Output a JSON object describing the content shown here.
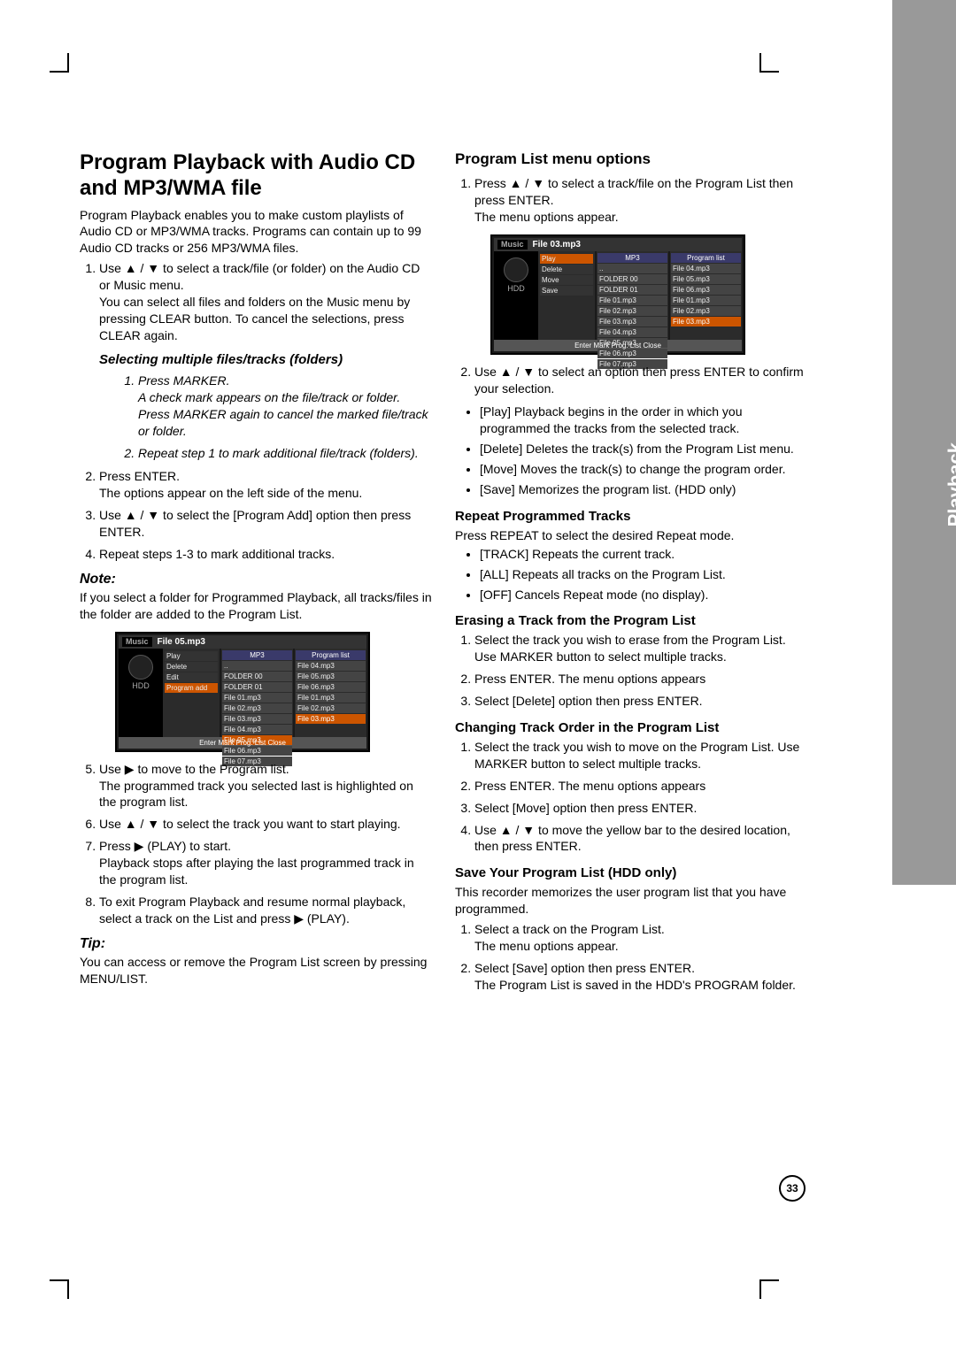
{
  "sideTab": "Playback",
  "pageNumber": "33",
  "left": {
    "h1": "Program Playback with Audio CD and MP3/WMA file",
    "intro": "Program Playback enables you to make custom playlists of Audio CD or MP3/WMA tracks. Programs can contain up to 99 Audio CD tracks or 256 MP3/WMA files.",
    "step1a": "Use ▲ / ▼ to select a track/file (or folder) on the Audio CD or Music menu.",
    "step1b": "You can select all files and folders on the Music menu by pressing CLEAR button. To cancel the selections, press CLEAR again.",
    "selHeading": "Selecting multiple files/tracks (folders)",
    "sel1a": "Press MARKER.",
    "sel1b": "A check mark appears on the file/track or folder. Press MARKER again to cancel the marked file/track or folder.",
    "sel2": "Repeat step 1 to mark additional file/track (folders).",
    "step2a": "Press ENTER.",
    "step2b": "The options appear on the left side of the menu.",
    "step3": "Use ▲ / ▼ to select the [Program Add] option then press ENTER.",
    "step4": "Repeat steps 1-3 to mark additional tracks.",
    "noteH": "Note:",
    "noteP": "If you select a folder for Programmed Playback, all tracks/files in the folder are added to the Program List.",
    "step5a": "Use ▶ to move to the Program list.",
    "step5b": "The programmed track you selected last is highlighted on the program list.",
    "step6": "Use ▲ / ▼ to select the track you want to start playing.",
    "step7a": "Press ▶ (PLAY) to start.",
    "step7b": "Playback stops after playing the last programmed track in the program list.",
    "step8": "To exit Program Playback and resume normal playback, select a track on the List and press ▶ (PLAY).",
    "tipH": "Tip:",
    "tipP": "You can access or remove the Program List screen by pressing MENU/LIST."
  },
  "right": {
    "h2": "Program List menu options",
    "r1a": "Press ▲ / ▼ to select a track/file on the Program List then press ENTER.",
    "r1b": "The menu options appear.",
    "r2": "Use ▲ / ▼ to select an option then press ENTER to confirm your selection.",
    "b1": "[Play] Playback begins in the order in which you programmed the tracks from the selected track.",
    "b2": "[Delete] Deletes the track(s) from the Program List menu.",
    "b3": "[Move] Moves the track(s) to change the program order.",
    "b4": "[Save] Memorizes the program list. (HDD only)",
    "repeatH": "Repeat Programmed Tracks",
    "repeatP": "Press REPEAT to select the desired Repeat mode.",
    "rb1": "[TRACK] Repeats the current track.",
    "rb2": "[ALL] Repeats all tracks on the Program List.",
    "rb3": "[OFF] Cancels Repeat mode (no display).",
    "eraseH": "Erasing a Track from the Program List",
    "e1": "Select the track you wish to erase from the Program List. Use MARKER button to select multiple tracks.",
    "e2": "Press ENTER. The menu options appears",
    "e3": "Select [Delete] option then press ENTER.",
    "changeH": "Changing Track Order in the Program List",
    "c1": "Select the track you wish to move on the Program List. Use MARKER button to select multiple tracks.",
    "c2": "Press ENTER. The menu options appears",
    "c3": "Select [Move] option then press ENTER.",
    "c4": "Use ▲ / ▼ to move the yellow bar to the desired location, then press ENTER.",
    "saveH": "Save Your Program List (HDD only)",
    "saveP": "This recorder memorizes the user program list that you have programmed.",
    "s1a": "Select a track on the Program List.",
    "s1b": "The menu options appear.",
    "s2a": "Select [Save] option then press ENTER.",
    "s2b": "The Program List is saved in the HDD's PROGRAM folder."
  },
  "shot1": {
    "title": "File 05.mp3",
    "music": "Music",
    "hdd": "HDD",
    "tab": "MP3",
    "progHdr": "Program list",
    "leftMenu": [
      "Play",
      "Delete",
      "Edit",
      "Program add"
    ],
    "mid": [
      "..",
      "FOLDER 00",
      "FOLDER 01",
      "File 01.mp3",
      "File 02.mp3",
      "File 03.mp3",
      "File 04.mp3",
      "File 05.mp3",
      "File 06.mp3",
      "File 07.mp3"
    ],
    "right": [
      "File 04.mp3",
      "File 05.mp3",
      "File 06.mp3",
      "File 01.mp3",
      "File 02.mp3",
      "File 03.mp3"
    ],
    "footer": "Enter  Mark  Prog. List  Close"
  },
  "shot2": {
    "title": "File 03.mp3",
    "music": "Music",
    "hdd": "HDD",
    "tab": "MP3",
    "progHdr": "Program list",
    "leftMenu": [
      "Play",
      "Delete",
      "Move",
      "Save"
    ],
    "mid": [
      "..",
      "FOLDER 00",
      "FOLDER 01",
      "File 01.mp3",
      "File 02.mp3",
      "File 03.mp3",
      "File 04.mp3",
      "File 05.mp3",
      "File 06.mp3",
      "File 07.mp3"
    ],
    "right": [
      "File 04.mp3",
      "File 05.mp3",
      "File 06.mp3",
      "File 01.mp3",
      "File 02.mp3",
      "File 03.mp3"
    ],
    "footer": "Enter  Mark  Prog. List  Close"
  }
}
